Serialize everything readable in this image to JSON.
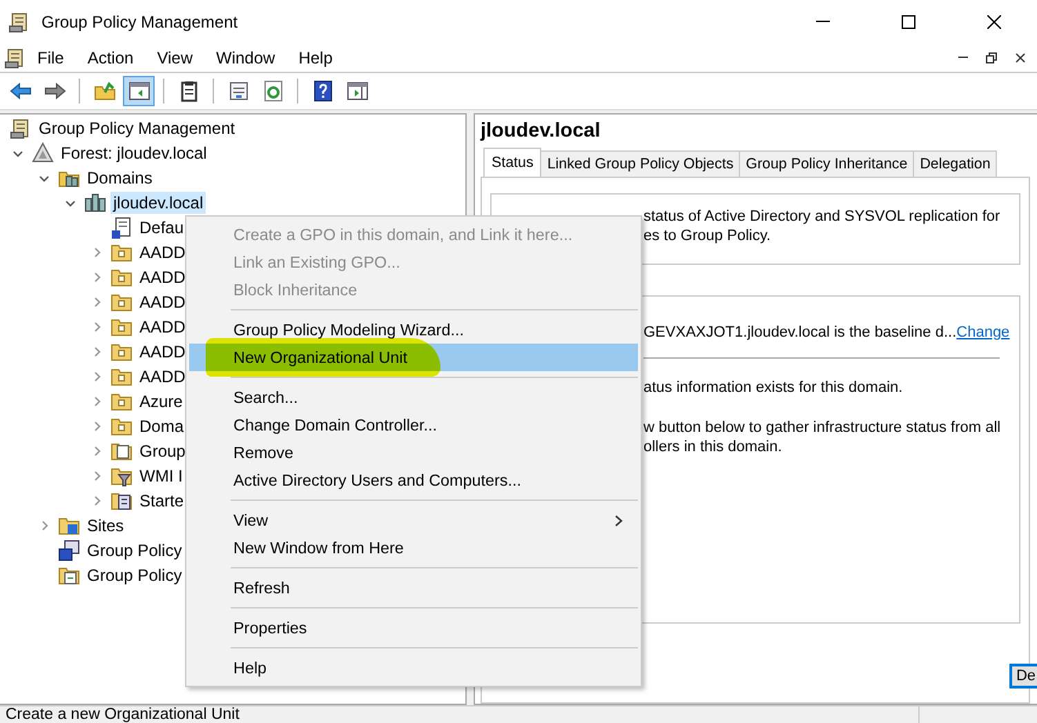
{
  "window": {
    "title": "Group Policy Management"
  },
  "menu_bar": {
    "items": [
      "File",
      "Action",
      "View",
      "Window",
      "Help"
    ]
  },
  "toolbar": {
    "buttons": [
      {
        "kind": "back",
        "pressed": false
      },
      {
        "kind": "forward",
        "pressed": false
      },
      {
        "kind": "separator"
      },
      {
        "kind": "up",
        "pressed": false
      },
      {
        "kind": "tree-toggle",
        "pressed": true
      },
      {
        "kind": "separator"
      },
      {
        "kind": "clipboard",
        "pressed": false
      },
      {
        "kind": "separator"
      },
      {
        "kind": "properties",
        "pressed": false
      },
      {
        "kind": "refresh",
        "pressed": false
      },
      {
        "kind": "separator"
      },
      {
        "kind": "help",
        "pressed": false
      },
      {
        "kind": "action-pane",
        "pressed": false
      }
    ]
  },
  "tree": {
    "items": [
      {
        "label": "Group Policy Management",
        "kind": "root",
        "selected": false,
        "children": [
          {
            "label": "Forest: jloudev.local",
            "kind": "forest",
            "selected": false,
            "expanded": true,
            "children": [
              {
                "label": "Domains",
                "kind": "domains",
                "selected": false,
                "expanded": true,
                "children": [
                  {
                    "label": "jloudev.local",
                    "kind": "domain",
                    "selected": true,
                    "expanded": true,
                    "children": [
                      {
                        "label": "Defau",
                        "kind": "gpo-link",
                        "selected": false
                      },
                      {
                        "label": "AADD",
                        "kind": "ou",
                        "selected": false,
                        "expanded": false
                      },
                      {
                        "label": "AADD",
                        "kind": "ou",
                        "selected": false,
                        "expanded": false
                      },
                      {
                        "label": "AADD",
                        "kind": "ou",
                        "selected": false,
                        "expanded": false
                      },
                      {
                        "label": "AADD",
                        "kind": "ou",
                        "selected": false,
                        "expanded": false
                      },
                      {
                        "label": "AADD",
                        "kind": "ou",
                        "selected": false,
                        "expanded": false
                      },
                      {
                        "label": "AADD",
                        "kind": "ou",
                        "selected": false,
                        "expanded": false
                      },
                      {
                        "label": "Azure",
                        "kind": "ou",
                        "selected": false,
                        "expanded": false
                      },
                      {
                        "label": "Doma",
                        "kind": "ou",
                        "selected": false,
                        "expanded": false
                      },
                      {
                        "label": "Group",
                        "kind": "gpo-folder",
                        "selected": false,
                        "expanded": false
                      },
                      {
                        "label": "WMI I",
                        "kind": "wmi",
                        "selected": false,
                        "expanded": false
                      },
                      {
                        "label": "Starte",
                        "kind": "starter",
                        "selected": false,
                        "expanded": false
                      }
                    ]
                  }
                ]
              },
              {
                "label": "Sites",
                "kind": "sites",
                "selected": false,
                "expanded": false
              },
              {
                "label": "Group Policy",
                "kind": "modeling",
                "selected": false
              },
              {
                "label": "Group Policy",
                "kind": "results",
                "selected": false
              }
            ]
          }
        ]
      }
    ]
  },
  "detail": {
    "heading": "jloudev.local",
    "tabs": [
      {
        "label": "Status",
        "selected": true
      },
      {
        "label": "Linked Group Policy Objects",
        "selected": false
      },
      {
        "label": "Group Policy Inheritance",
        "selected": false
      },
      {
        "label": "Delegation",
        "selected": false
      }
    ],
    "intro_lines": [
      "status of Active Directory and SYSVOL replication for",
      "es to Group Policy."
    ],
    "baseline_text": "GEVXAXJOT1.jloudev.local is the baseline d...",
    "change_link": "Change",
    "status_lines": [
      "atus information exists for this domain."
    ],
    "gather_lines": [
      "w button below to gather infrastructure status from all",
      "ollers in this domain."
    ],
    "button": "De"
  },
  "context_menu": {
    "groups": [
      [
        {
          "label": "Create a GPO in this domain, and Link it here...",
          "disabled": true,
          "selected": false,
          "highlighted": false,
          "submenu": false
        },
        {
          "label": "Link an Existing GPO...",
          "disabled": true,
          "selected": false,
          "highlighted": false,
          "submenu": false
        },
        {
          "label": "Block Inheritance",
          "disabled": true,
          "selected": false,
          "highlighted": false,
          "submenu": false
        }
      ],
      [
        {
          "label": "Group Policy Modeling Wizard...",
          "disabled": false,
          "selected": false,
          "highlighted": false,
          "submenu": false
        },
        {
          "label": "New Organizational Unit",
          "disabled": false,
          "selected": true,
          "highlighted": true,
          "submenu": false
        }
      ],
      [
        {
          "label": "Search...",
          "disabled": false,
          "selected": false,
          "highlighted": false,
          "submenu": false
        },
        {
          "label": "Change Domain Controller...",
          "disabled": false,
          "selected": false,
          "highlighted": false,
          "submenu": false
        },
        {
          "label": "Remove",
          "disabled": false,
          "selected": false,
          "highlighted": false,
          "submenu": false
        },
        {
          "label": "Active Directory Users and Computers...",
          "disabled": false,
          "selected": false,
          "highlighted": false,
          "submenu": false
        }
      ],
      [
        {
          "label": "View",
          "disabled": false,
          "selected": false,
          "highlighted": false,
          "submenu": true
        },
        {
          "label": "New Window from Here",
          "disabled": false,
          "selected": false,
          "highlighted": false,
          "submenu": false
        }
      ],
      [
        {
          "label": "Refresh",
          "disabled": false,
          "selected": false,
          "highlighted": false,
          "submenu": false
        }
      ],
      [
        {
          "label": "Properties",
          "disabled": false,
          "selected": false,
          "highlighted": false,
          "submenu": false
        }
      ],
      [
        {
          "label": "Help",
          "disabled": false,
          "selected": false,
          "highlighted": false,
          "submenu": false
        }
      ]
    ]
  },
  "status_bar": {
    "text": "Create a new Organizational Unit"
  }
}
